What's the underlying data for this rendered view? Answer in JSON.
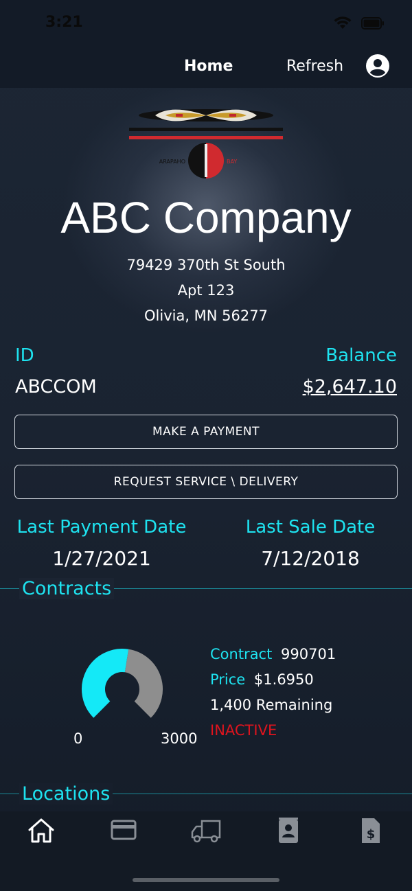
{
  "status_bar": {
    "time": "3:21",
    "icons": [
      "wifi-icon",
      "battery-icon"
    ]
  },
  "nav": {
    "home": "Home",
    "refresh": "Refresh",
    "profile_icon": "account-circle-icon"
  },
  "logo": {
    "left_text": "ARAPAHO",
    "right_text": "BAY"
  },
  "company": {
    "name": "ABC Company",
    "address_line1": "79429 370th St South",
    "address_line2": "Apt 123",
    "address_line3": "Olivia, MN 56277"
  },
  "account": {
    "id_label": "ID",
    "id_value": "ABCCOM",
    "balance_label": "Balance",
    "balance_value": "$2,647.10"
  },
  "actions": {
    "make_payment": "MAKE A PAYMENT",
    "request_service": "REQUEST SERVICE \\ DELIVERY"
  },
  "dates": {
    "last_payment_label": "Last Payment Date",
    "last_payment_value": "1/27/2021",
    "last_sale_label": "Last Sale Date",
    "last_sale_value": "7/12/2018"
  },
  "contracts": {
    "section_title": "Contracts",
    "gauge": {
      "min": "0",
      "max": "3000",
      "used_fraction": 0.533,
      "used_color": "#14e9f7",
      "remaining_color": "#8e8e8e"
    },
    "contract_label": "Contract",
    "contract_value": "990701",
    "price_label": "Price",
    "price_value": "$1.6950",
    "remaining": "1,400 Remaining",
    "status": "INACTIVE"
  },
  "locations": {
    "section_title": "Locations"
  },
  "tabs": [
    "home-icon",
    "credit-card-icon",
    "truck-icon",
    "contact-icon",
    "invoice-dollar-icon"
  ],
  "colors": {
    "accent": "#1ee3f0",
    "inactive": "#e0141e",
    "background": "#1a2330"
  }
}
